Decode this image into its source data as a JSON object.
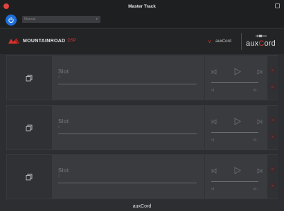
{
  "window": {
    "title": "Master Track"
  },
  "toolbar": {
    "preset": "Manual",
    "power_icon": "power-icon"
  },
  "header": {
    "brand_name": "MOUNTAINROAD",
    "brand_suffix": "DSP",
    "selector_label": "auxCord",
    "logo_text_a": "aux",
    "logo_text_c": "C",
    "logo_text_rest": "ord"
  },
  "slots": [
    {
      "title": "Slot",
      "subtitle": "//"
    },
    {
      "title": "Slot",
      "subtitle": "//"
    },
    {
      "title": "Slot",
      "subtitle": "//"
    }
  ],
  "footer": {
    "label": "auxCord"
  },
  "colors": {
    "accent_red": "#d9342b",
    "power_blue": "#1f6fd8"
  }
}
